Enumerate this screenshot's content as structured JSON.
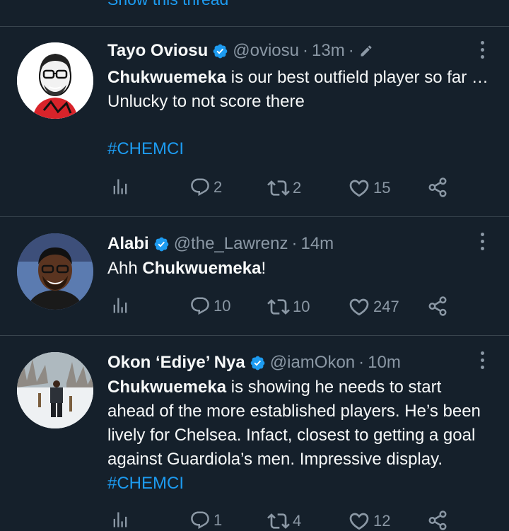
{
  "top_link": "Show this thread",
  "tweets": [
    {
      "name": "Tayo Oviosu",
      "handle": "@oviosu",
      "time": "13m",
      "text_bold": "Chukwuemeka",
      "text_rest": " is our best outfield player so far … Unlucky to not score there",
      "hashtag": "#CHEMCI",
      "replies": "2",
      "retweets": "2",
      "likes": "15"
    },
    {
      "name": "Alabi",
      "handle": "@the_Lawrenz",
      "time": "14m",
      "text_prefix": "Ahh ",
      "text_bold": "Chukwuemeka",
      "text_rest": "!",
      "replies": "10",
      "retweets": "10",
      "likes": "247"
    },
    {
      "name": "Okon ‘Ediye’ Nya",
      "handle": "@iamOkon",
      "time": "10m",
      "text_bold": "Chukwuemeka",
      "text_rest": " is showing he needs to start ahead of the more established players. He’s been lively for Chelsea. Infact, closest to getting a goal against Guardiola’s men. Impressive display. ",
      "hashtag": "#CHEMCI",
      "replies": "1",
      "retweets": "4",
      "likes": "12"
    }
  ],
  "separator": "·",
  "icons": {
    "verified": "verified-badge-icon",
    "edited": "pencil-edit-icon",
    "more": "more-options-icon",
    "analytics": "analytics-icon",
    "reply": "reply-icon",
    "retweet": "retweet-icon",
    "like": "heart-icon",
    "share": "share-icon"
  },
  "colors": {
    "background": "#15202b",
    "accent": "#1d9bf0",
    "muted": "#8b98a5",
    "text": "#f7f9f9",
    "divider": "#38444d"
  }
}
